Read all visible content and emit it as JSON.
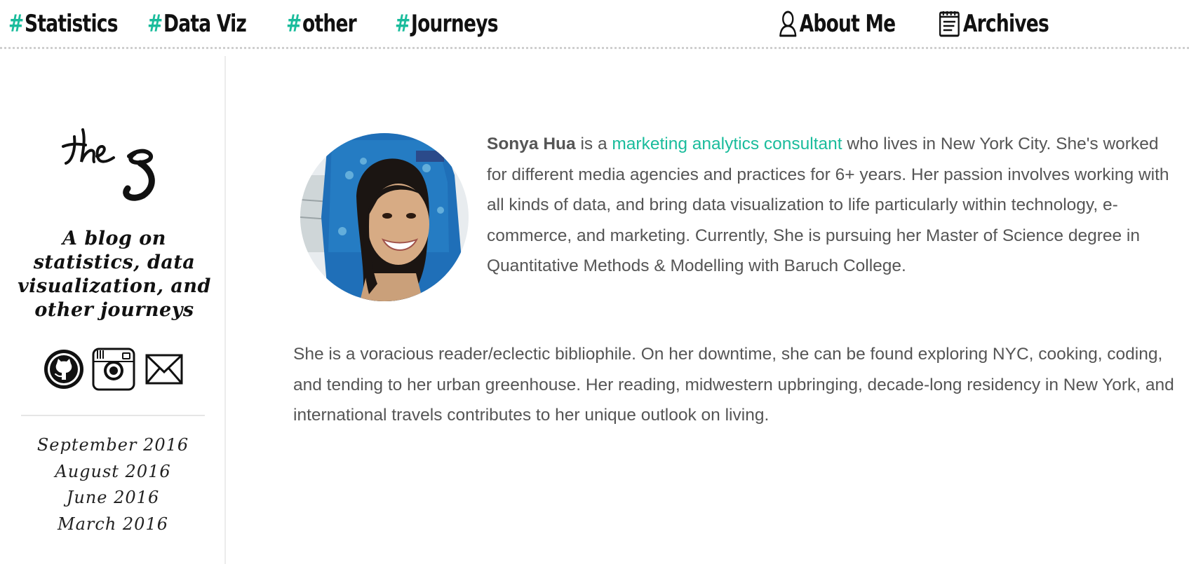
{
  "nav": {
    "items": [
      {
        "hash": "#",
        "label": "Statistics"
      },
      {
        "hash": "#",
        "label": "Data Viz"
      },
      {
        "hash": "#",
        "label": "other"
      },
      {
        "hash": "#",
        "label": "Journeys"
      }
    ],
    "about_label": "About Me",
    "archives_label": "Archives",
    "accent_color": "#1abc9c"
  },
  "sidebar": {
    "logo_text": "the S",
    "tagline": "A blog on statistics, data visualization, and other journeys",
    "social": [
      {
        "icon": "github-icon"
      },
      {
        "icon": "instagram-icon"
      },
      {
        "icon": "mail-icon"
      }
    ],
    "archives": [
      "September 2016",
      "August 2016",
      "June 2016",
      "March 2016"
    ]
  },
  "about": {
    "name": "Sonya Hua",
    "is_a": "is a",
    "role": "marketing analytics consultant",
    "bio_rest": "who lives in New York City. She's worked for different media agencies and practices for 6+ years. Her passion involves working with all kinds of data, and bring data visualization to life particularly within technology, e-commerce, and marketing. Currently, She is pursuing her Master of Science degree in Quantitative Methods & Modelling with Baruch College.",
    "bio_second": "She is a voracious reader/eclectic bibliophile. On her downtime, she can be found exploring NYC, cooking, coding, and tending to her urban greenhouse. Her reading, midwestern upbringing, decade-long residency in New York, and international travels contributes to her unique outlook on living."
  }
}
